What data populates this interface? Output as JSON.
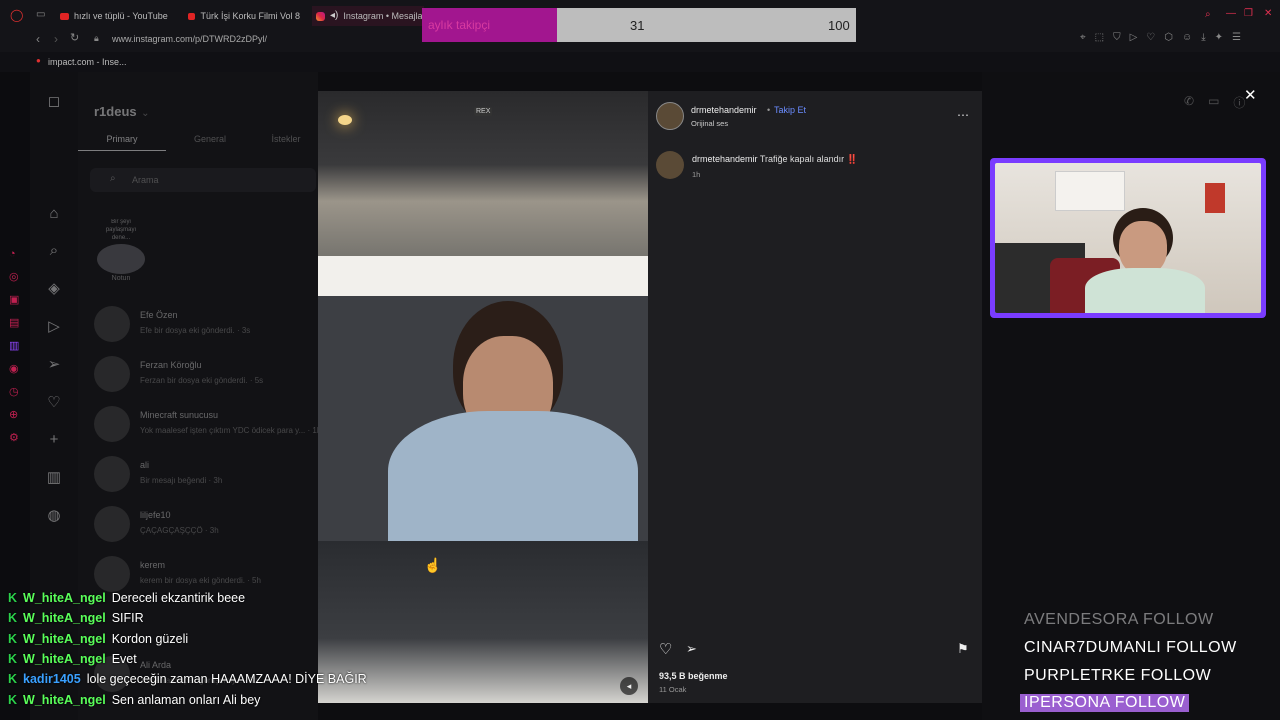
{
  "tabs": [
    {
      "label": "hızlı ve tüplü - YouTube"
    },
    {
      "label": "Türk İşi Korku Filmi Vol 8"
    },
    {
      "label": "Instagram • Mesajla"
    }
  ],
  "address": {
    "url": "www.instagram.com/p/DTWRD2zDPyl/"
  },
  "bookmark": {
    "label": "impact.com - Inse..."
  },
  "goal": {
    "label": "aylık takipçi",
    "current": "31",
    "target": "100",
    "progress": 0.31
  },
  "instagram": {
    "account": "r1deus",
    "tabs": [
      "Primary",
      "General",
      "İstekler"
    ],
    "search_placeholder": "Arama",
    "note_label": "Notun",
    "note_bubble": "Bir şeyi paylaşmayı dene...",
    "threads": [
      {
        "name": "Efe Özen",
        "preview": "Efe bir dosya eki gönderdi. · 3s"
      },
      {
        "name": "Ferzan Köroğlu",
        "preview": "Ferzan bir dosya eki gönderdi. · 5s"
      },
      {
        "name": "Minecraft sunucusu",
        "preview": "Yok maalesef işten çıktım YDC ödicek para y... · 1h"
      },
      {
        "name": "ali",
        "preview": "Bir mesajı beğendi · 3h"
      },
      {
        "name": "liljefe10",
        "preview": "ÇAÇAGÇAŞÇÇÖ · 3h"
      },
      {
        "name": "kerem",
        "preview": "kerem bir dosya eki gönderdi. · 5h"
      },
      {
        "name": "Ali Arda",
        "preview": "zamanlarda pek görüşemiy... · 5h"
      }
    ],
    "post": {
      "author": "drmetehandemir",
      "follow_label": "Takip Et",
      "audio": "Orijinal ses",
      "caption_author": "drmetehandemir",
      "caption": "Trafiğe kapalı alandır ‼️",
      "caption_time": "1h",
      "likes": "93,5 B beğenme",
      "date": "11 Ocak",
      "watermark": "REX"
    }
  },
  "chat": [
    {
      "user": "W_hiteA_ngel",
      "message": "Dereceli ekzantirik beee",
      "color": "#5aff5a"
    },
    {
      "user": "W_hiteA_ngel",
      "message": "SIFIR",
      "color": "#5aff5a"
    },
    {
      "user": "W_hiteA_ngel",
      "message": "Kordon güzeli",
      "color": "#5aff5a"
    },
    {
      "user": "W_hiteA_ngel",
      "message": "Evet",
      "color": "#5aff5a"
    },
    {
      "user": "kadir1405",
      "message": "lole geçeceğin zaman HAAAMZAAA! DİYE BAĞIR",
      "color": "#3aa0ff"
    },
    {
      "user": "W_hiteA_ngel",
      "message": "Sen anlaman onları Ali bey",
      "color": "#5aff5a"
    }
  ],
  "follows": [
    {
      "name": "AVENDESORA",
      "action": "FOLLOW"
    },
    {
      "name": "CINAR7DUMANLI",
      "action": "FOLLOW"
    },
    {
      "name": "PURPLETRKE",
      "action": "FOLLOW"
    },
    {
      "name": "IPERSONA",
      "action": "FOLLOW"
    }
  ],
  "colors": {
    "accent": "#a2168f",
    "webcam_border": "#7a3cff",
    "follow_highlight": "#9a5fd0",
    "link": "#6b8cff"
  }
}
